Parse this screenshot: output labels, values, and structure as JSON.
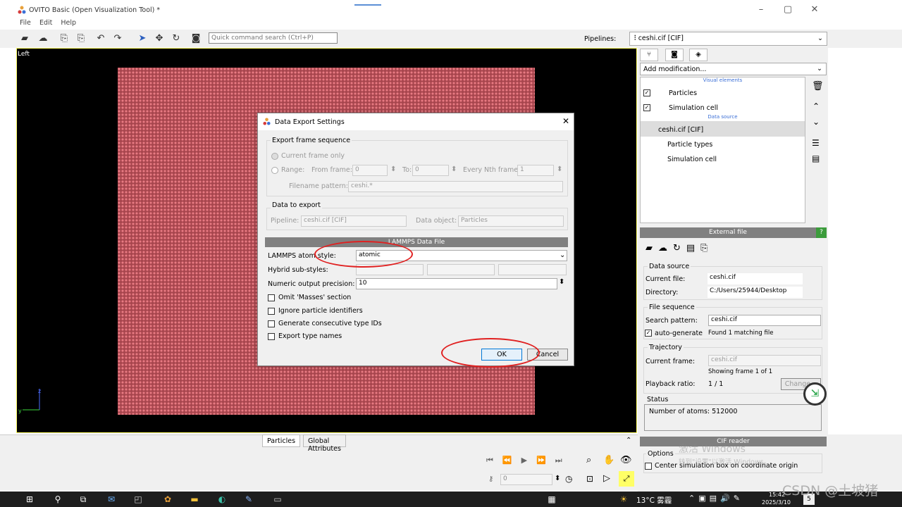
{
  "window": {
    "title": "OVITO Basic (Open Visualization Tool) *"
  },
  "menu": {
    "file": "File",
    "edit": "Edit",
    "help": "Help"
  },
  "toolbar": {
    "search_placeholder": "Quick command search (Ctrl+P)",
    "pipelines_label": "Pipelines:",
    "pipeline_value": "ceshi.cif [CIF]"
  },
  "viewport": {
    "label": "Left",
    "axis_z": "z",
    "axis_y": "y"
  },
  "dialog": {
    "title": "Data Export Settings",
    "frame_group": "Export frame sequence",
    "current_frame": "Current frame only",
    "range": "Range:",
    "from_frame": "From frame:",
    "from_value": "0",
    "to": "To:",
    "to_value": "0",
    "every_nth": "Every Nth frame:",
    "every_value": "1",
    "filename_pattern": "Filename pattern:",
    "filename_value": "ceshi.*",
    "data_group": "Data to export",
    "pipeline": "Pipeline:",
    "pipeline_value": "ceshi.cif [CIF]",
    "data_object": "Data object:",
    "data_object_value": "Particles",
    "lammps_header": "LAMMPS Data File",
    "atom_style_label": "LAMMPS atom style:",
    "atom_style_value": "atomic",
    "hybrid_label": "Hybrid sub-styles:",
    "precision_label": "Numeric output precision:",
    "precision_value": "10",
    "omit_masses": "Omit 'Masses' section",
    "ignore_ids": "Ignore particle identifiers",
    "consecutive_ids": "Generate consecutive type IDs",
    "export_type_names": "Export type names",
    "ok": "OK",
    "cancel": "Cancel"
  },
  "bottom": {
    "tab_particles": "Particles",
    "tab_global": "Global Attributes",
    "frame_value": "0"
  },
  "right": {
    "add_modification": "Add modification...",
    "visual_elements": "Visual elements",
    "particles": "Particles",
    "simulation_cell": "Simulation cell",
    "data_source": "Data source",
    "source_file": "ceshi.cif [CIF]",
    "particle_types": "Particle types",
    "simulation_cell2": "Simulation cell",
    "external_file": "External file",
    "help": "?",
    "ds_group": "Data source",
    "current_file_label": "Current file:",
    "current_file": "ceshi.cif",
    "directory_label": "Directory:",
    "directory": "C:/Users/25944/Desktop",
    "file_sequence": "File sequence",
    "search_pattern_label": "Search pattern:",
    "search_pattern": "ceshi.cif",
    "auto_generate": "auto-generate",
    "found": "Found 1 matching file",
    "trajectory": "Trajectory",
    "current_frame_label": "Current frame:",
    "current_frame": "ceshi.cif",
    "showing_frame": "Showing frame 1 of 1",
    "playback_label": "Playback ratio:",
    "playback": "1 / 1",
    "change": "Change...",
    "status": "Status",
    "atoms": "Number of atoms: 512000",
    "cif_reader": "CIF reader",
    "options": "Options",
    "center_box": "Center simulation box on coordinate origin",
    "activate_line1": "激活 Windows",
    "activate_line2": "转到\"设置\"以激活 Windows。"
  },
  "taskbar": {
    "weather": "13°C 雾霾",
    "time": "15:42",
    "date": "2025/3/10",
    "badge": "5"
  },
  "watermark": "CSDN @土坡猪"
}
